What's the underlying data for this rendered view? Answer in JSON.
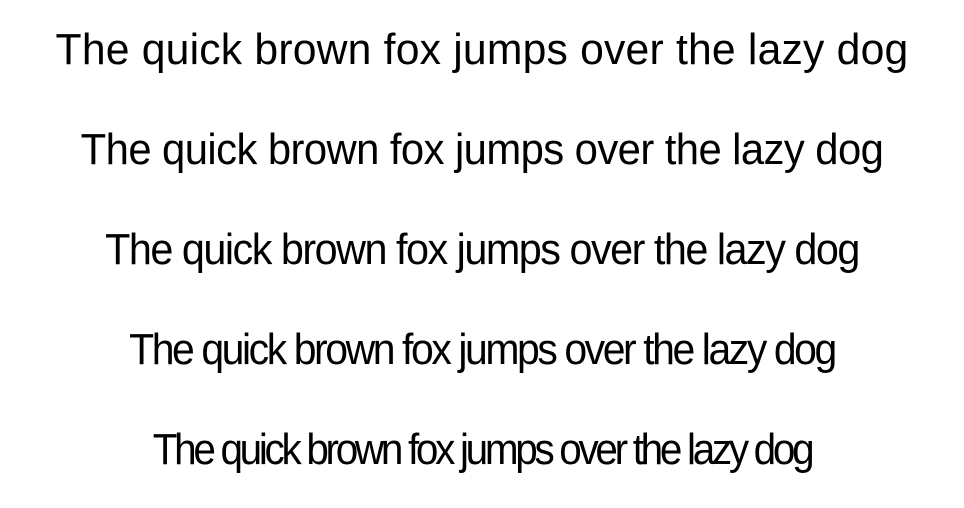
{
  "specimens": [
    "The quick brown fox jumps over the lazy dog",
    "The quick brown fox jumps over the lazy dog",
    "The quick brown fox jumps over the lazy dog",
    "The quick brown fox jumps over the lazy dog",
    "The quick brown fox jumps over the lazy dog"
  ],
  "colors": {
    "background": "#ffffff",
    "text": "#000000"
  }
}
